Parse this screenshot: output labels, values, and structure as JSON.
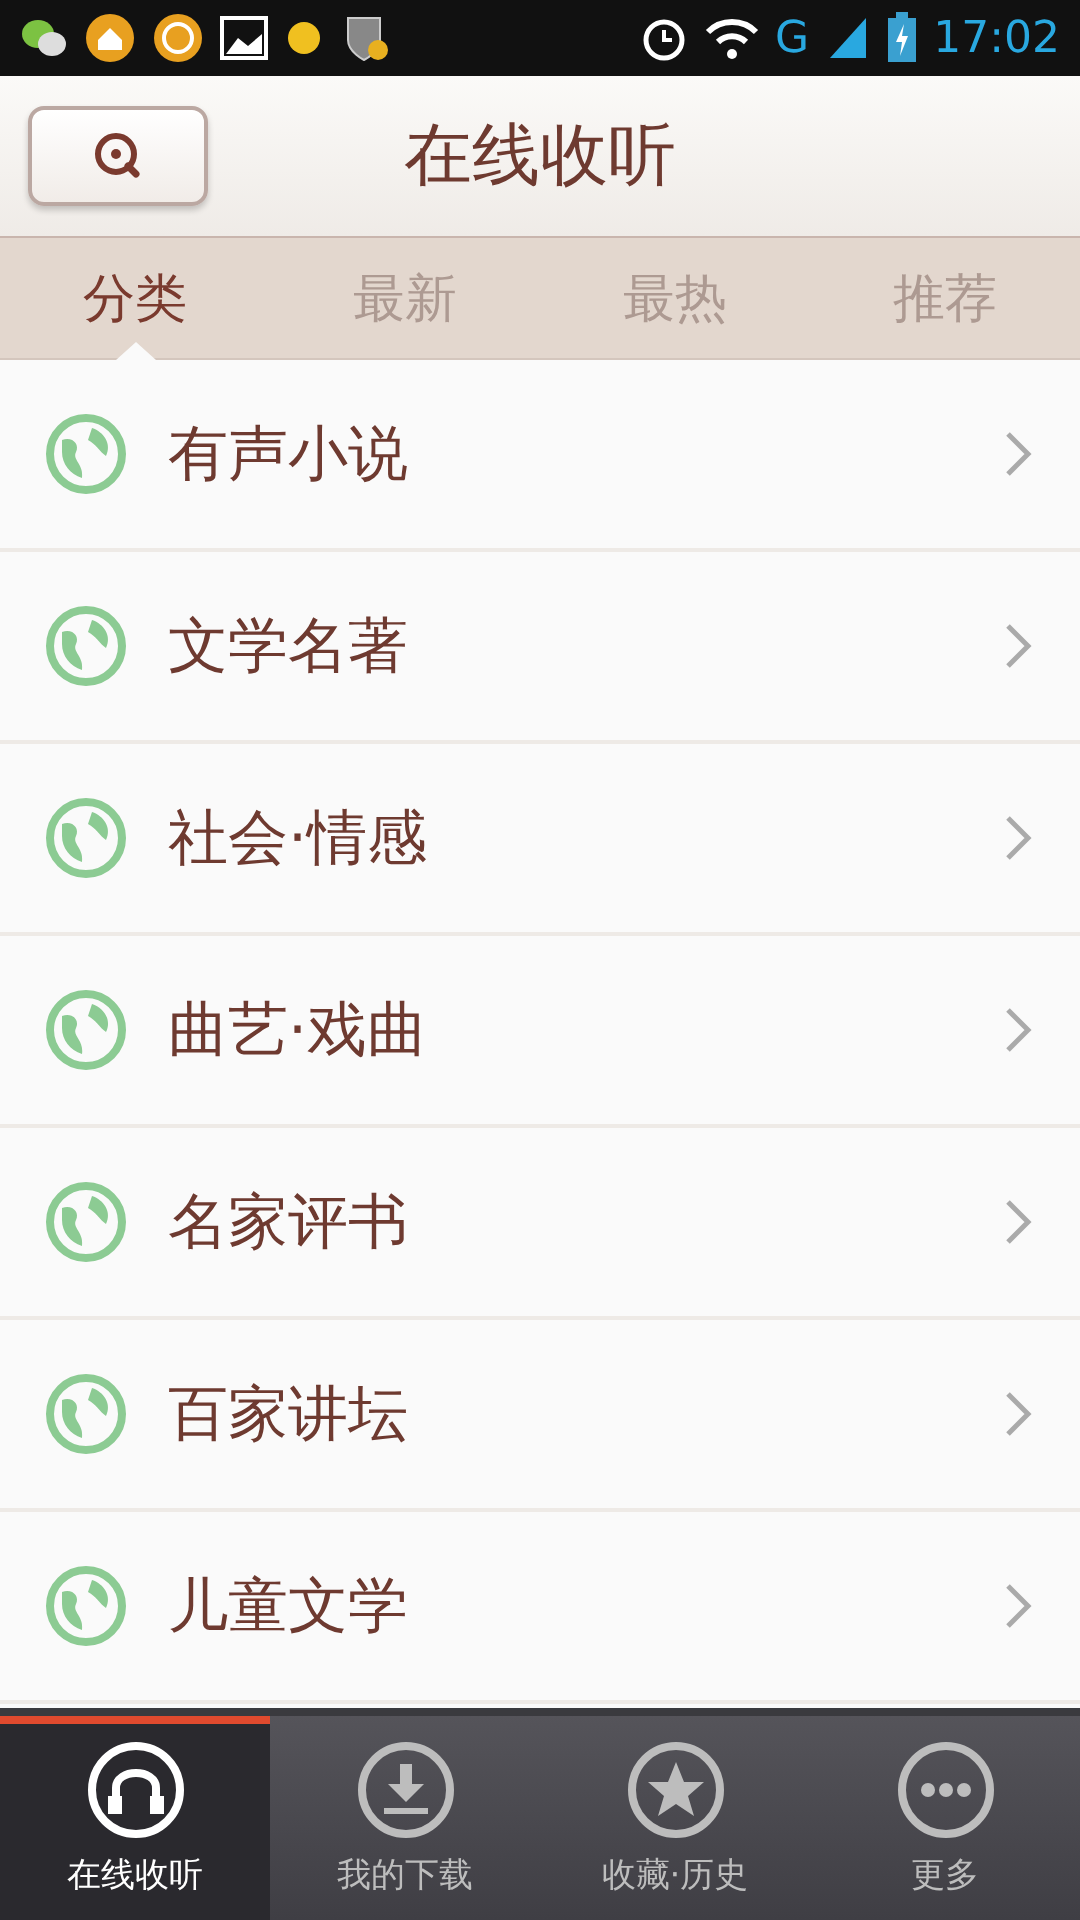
{
  "status_bar": {
    "network": "G",
    "time": "17:02"
  },
  "header": {
    "title": "在线收听"
  },
  "tabs": [
    {
      "label": "分类",
      "selected": true
    },
    {
      "label": "最新",
      "selected": false
    },
    {
      "label": "最热",
      "selected": false
    },
    {
      "label": "推荐",
      "selected": false
    }
  ],
  "categories": [
    {
      "label": "有声小说"
    },
    {
      "label": "文学名著"
    },
    {
      "label": "社会·情感"
    },
    {
      "label": "曲艺·戏曲"
    },
    {
      "label": "名家评书"
    },
    {
      "label": "百家讲坛"
    },
    {
      "label": "儿童文学"
    }
  ],
  "bottom_nav": [
    {
      "label": "在线收听",
      "kind": "headphones",
      "selected": true
    },
    {
      "label": "我的下载",
      "kind": "download",
      "selected": false
    },
    {
      "label": "收藏·历史",
      "kind": "star",
      "selected": false
    },
    {
      "label": "更多",
      "kind": "more",
      "selected": false
    }
  ]
}
